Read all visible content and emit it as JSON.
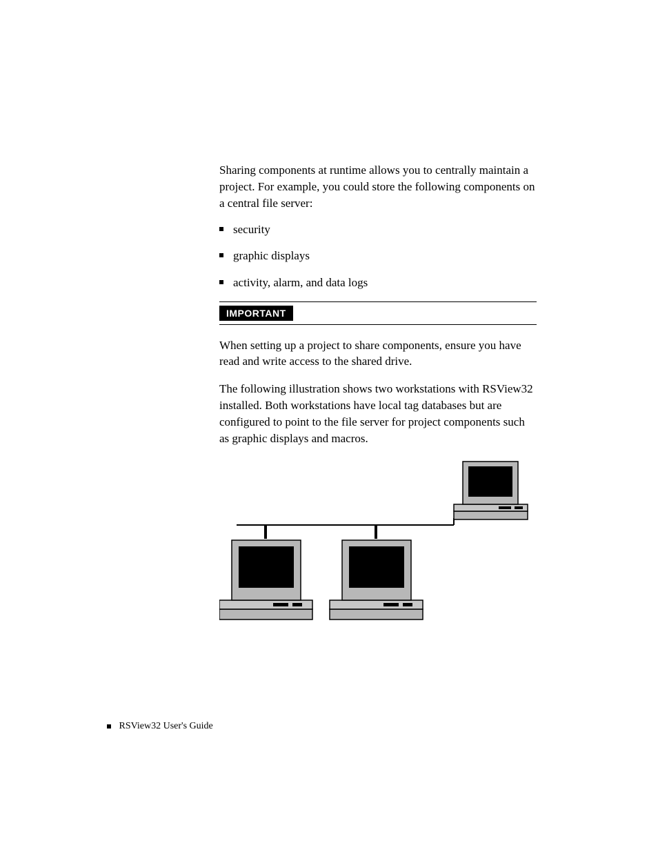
{
  "content": {
    "intro": "Sharing components at runtime allows you to centrally maintain a project. For example, you could store the following components on a central file server:",
    "bullets": [
      "security",
      "graphic displays",
      "activity, alarm, and data logs"
    ],
    "importantLabel": "IMPORTANT",
    "afterImportant": "When setting up a project to share components, ensure you have read and write access to the shared drive.",
    "illustration": "The following illustration shows two workstations with RSView32 installed. Both workstations have local tag databases but are configured to point to the file server for project components such as graphic displays and macros."
  },
  "footer": {
    "text": "RSView32  User's Guide"
  }
}
